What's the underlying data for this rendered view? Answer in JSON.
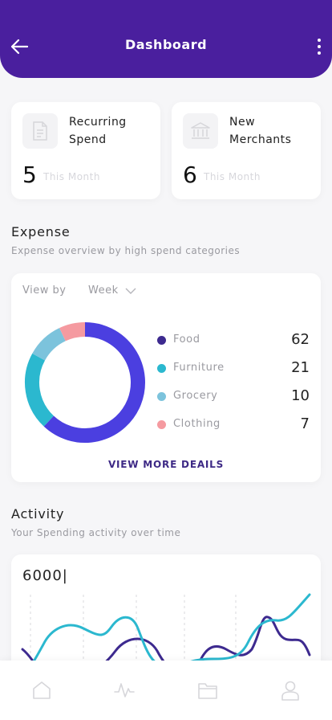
{
  "header": {
    "title": "Dashboard",
    "back_icon": "arrow-left-icon",
    "more_icon": "more-vertical-icon",
    "color": "#4a1f9e"
  },
  "stats": [
    {
      "label": "Recurring Spend",
      "value": "5",
      "sub": "This Month",
      "icon": "document-icon"
    },
    {
      "label": "New Merchants",
      "value": "6",
      "sub": "This Month",
      "icon": "bank-icon"
    }
  ],
  "expense": {
    "title": "Expense",
    "subtitle": "Expense overview by high spend categories",
    "view_by_label": "View by",
    "view_by_value": "Week",
    "more_link": "VIEW MORE DEAILS",
    "categories": [
      {
        "name": "Food",
        "value": 62,
        "color": "#4b3fe0"
      },
      {
        "name": "Furniture",
        "value": 21,
        "color": "#2bb8cf"
      },
      {
        "name": "Grocery",
        "value": 10,
        "color": "#7cc3dc"
      },
      {
        "name": "Clothing",
        "value": 7,
        "color": "#f59aa0"
      }
    ]
  },
  "activity": {
    "title": "Activity",
    "subtitle": "Your Spending activity over time",
    "value": "6000|"
  },
  "nav": [
    "home-icon",
    "activity-icon",
    "folder-icon",
    "profile-icon"
  ]
}
